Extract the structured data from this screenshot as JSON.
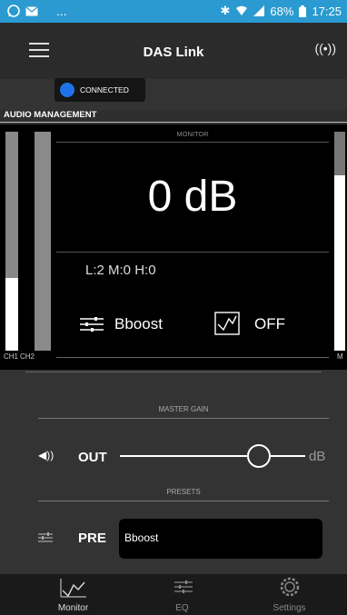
{
  "status": {
    "left_icons": [
      "whatsapp-icon",
      "mail-icon"
    ],
    "left_more": "...",
    "battery": "68%",
    "time": "17:25"
  },
  "app": {
    "title": "DAS Link",
    "connection_status": "CONNECTED",
    "section_header": "AUDIO MANAGEMENT"
  },
  "monitor": {
    "label": "MONITOR",
    "level": "0 dB",
    "counters": "L:2 M:0 H:0",
    "preset_name": "Bboost",
    "analyzer_state": "OFF",
    "ch1_label": "CH1",
    "ch2_label": "CH2",
    "m_label": "M",
    "ch1_level": 0.33,
    "ch2_level": 0.0,
    "m_level": 0.8
  },
  "gain": {
    "label": "MASTER GAIN",
    "out_label": "OUT",
    "unit": "dB",
    "slider_value": 0.75
  },
  "presets": {
    "label": "PRESETS",
    "pre_label": "PRE",
    "current": "Bboost"
  },
  "nav": {
    "items": [
      {
        "label": "Monitor",
        "icon": "waveform-icon",
        "active": true
      },
      {
        "label": "EQ",
        "icon": "sliders-icon",
        "active": false
      },
      {
        "label": "Settings",
        "icon": "gear-icon",
        "active": false
      }
    ]
  }
}
